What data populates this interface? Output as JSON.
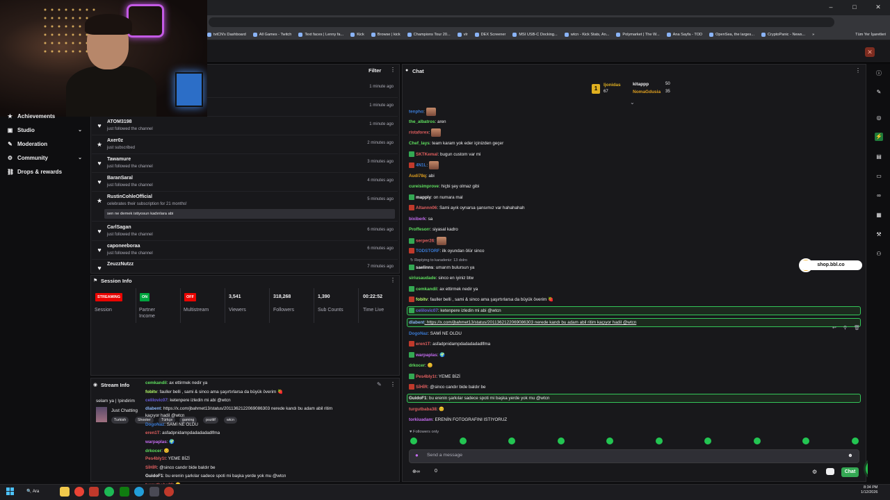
{
  "browser": {
    "bookmarks": [
      "tvtCN's Dashboard",
      "All Games - Twitch",
      "Text faces | Lenny fa...",
      "Kick",
      "Browse | kick",
      "Champions Tour 20...",
      "vlr",
      "DEX Screener",
      "MSI USB-C Docking...",
      "wtcn - Kick Stats, An...",
      "Polymarket | The W...",
      "Ana Sayfa - TOD",
      "OpenSea, the larges...",
      "CryptoPanic - News..."
    ],
    "bookmarks_more": "»",
    "all_bookmarks": "Tüm Yer İşaretleri",
    "win_controls": [
      "–",
      "□",
      "✕"
    ]
  },
  "leftnav": {
    "items": [
      {
        "label": "Achievements",
        "icon": "trophy-icon",
        "glyph": "★",
        "chev": ""
      },
      {
        "label": "Studio",
        "icon": "studio-icon",
        "glyph": "▣",
        "chev": "⌄"
      },
      {
        "label": "Moderation",
        "icon": "sword-icon",
        "glyph": "✎",
        "chev": ""
      },
      {
        "label": "Community",
        "icon": "gear-icon",
        "glyph": "⚙",
        "chev": "⌄"
      },
      {
        "label": "Drops & rewards",
        "icon": "link-icon",
        "glyph": "⛓",
        "chev": ""
      }
    ]
  },
  "activity": {
    "filter_label": "Filter",
    "dots": "⋮",
    "rows": [
      {
        "user": "",
        "sub": "",
        "time": "1 minute ago",
        "glyph": ""
      },
      {
        "user": "",
        "sub": "",
        "time": "1 minute ago",
        "glyph": ""
      },
      {
        "user": "ATOM3198",
        "sub": "just followed the channel",
        "time": "1 minute ago",
        "glyph": "♥"
      },
      {
        "user": "Axer0z",
        "sub": "just subscribed",
        "time": "2 minutes ago",
        "glyph": "★"
      },
      {
        "user": "Tawamure",
        "sub": "just followed the channel",
        "time": "3 minutes ago",
        "glyph": "♥"
      },
      {
        "user": "BaranSaral",
        "sub": "just followed the channel",
        "time": "4 minutes ago",
        "glyph": "♥"
      },
      {
        "user": "RustinCohleOfficial",
        "sub": "celebrates their subscription for 21 months!",
        "time": "5 minutes ago",
        "glyph": "★"
      },
      {
        "user": "CarlSagan",
        "sub": "just followed the channel",
        "time": "6 minutes ago",
        "glyph": "♥"
      },
      {
        "user": "caponeeboraa",
        "sub": "just followed the channel",
        "time": "6 minutes ago",
        "glyph": "♥"
      },
      {
        "user": "ZeuzzNutzz",
        "sub": "",
        "time": "7 minutes ago",
        "glyph": "♥"
      }
    ],
    "sub_message": "sen ne demek istiyosun kadınlara abi"
  },
  "session": {
    "title": "Session Info",
    "dots": "⋮",
    "icon": "⚑",
    "badges": [
      {
        "text": "STREAMING",
        "label": "Session",
        "color": "#eb0400"
      },
      {
        "text": "ON",
        "label": "Partner Income",
        "color": "#00a53f"
      },
      {
        "text": "OFF",
        "label": "Multistream",
        "color": "#eb0400"
      }
    ],
    "stats": [
      {
        "value": "3,541",
        "label": "Viewers"
      },
      {
        "value": "318,268",
        "label": "Followers"
      },
      {
        "value": "1,390",
        "label": "Sub Counts"
      },
      {
        "value": "00:22:52",
        "label": "Time Live"
      }
    ]
  },
  "streaminfo": {
    "title": "Stream Info",
    "icon": "◉",
    "edit": "✎",
    "dots": "⋮",
    "stream_title": "selam ya | !pindirim",
    "category": "Just Chatting",
    "tags": [
      "Turkish",
      "Shooter",
      "Türkçe",
      "gaming",
      "pozitif",
      "wtcn"
    ]
  },
  "mini_chat": [
    {
      "user": "cemkandil",
      "color": "#5fe05f",
      "text": ": ax ettirmek nedir ya"
    },
    {
      "user": "fobitv",
      "color": "#b6ff6b",
      "text": ": fauller belli , sami & sinco ama şaşırtırlarsa da büyük överim 🍓"
    },
    {
      "user": "celilovic07",
      "color": "#6b5fe0",
      "text": ": ketenpere izledin mi abi @wtcn"
    },
    {
      "user": "dlabent",
      "color": "#8ab4f8",
      "text": ": https://x.com/jbahmet13/status/2011362122069086303 nerede kandı bu adam abil ritim"
    },
    {
      "user": "",
      "color": "#efeff1",
      "text": "kaçıyor hadil @wtcn"
    },
    {
      "user": "DogoNaz",
      "color": "#3a7bd5",
      "text": ": SAMİ NE OLDU"
    },
    {
      "user": "eren1T",
      "color": "#e05f5f",
      "text": ": asfadpnidampdadadadadlfma"
    },
    {
      "user": "warpaplas",
      "color": "#c46cf0",
      "text": ": 🌍"
    },
    {
      "user": "drkocer",
      "color": "#5fe05f",
      "text": ": 😊"
    },
    {
      "user": "Pes4bly1t",
      "color": "#e05f5f",
      "text": ": YEME BİZİ"
    },
    {
      "user": "SİHİR",
      "color": "#e05f5f",
      "text": ": @sinco candır bide baldır be"
    },
    {
      "user": "GuidoF1",
      "color": "#efeff1",
      "text": ": bu erenin şarkılar sadece spoti mi başka yerde yok mu @wtcn"
    },
    {
      "user": "turgutbaba38",
      "color": "#e05f5f",
      "text": ": 😊"
    },
    {
      "user": "tork",
      "color": "#e05f5f",
      "text": "ERENİN FOTOGRAFINI ISTIYORUZ"
    }
  ],
  "chat": {
    "title": "Chat",
    "icon": "●",
    "dots": "⋮",
    "leaderboard": {
      "first": {
        "name": "ljonidas",
        "value": "67"
      },
      "second": {
        "name": "kitappp",
        "value": "50"
      },
      "third": {
        "name": "NomaGdusia",
        "value": "35"
      }
    },
    "reply_note": "↻ Replying to karadeniz: 13 dolro",
    "messages": [
      {
        "user": "tenpho",
        "color": "#3a7bd5",
        "text": ": ",
        "emote": true
      },
      {
        "user": "the_albatros",
        "color": "#5fe05f",
        "text": ": aren"
      },
      {
        "user": "ristaforex",
        "color": "#e05f5f",
        "text": ": ",
        "emote": true
      },
      {
        "user": "Chef_lays",
        "color": "#5fe05f",
        "text": ": team karam yok eder içinizden geçer"
      },
      {
        "user": "SKTKemal",
        "color": "#e05f5f",
        "text": ": bugun custom var mi",
        "badge": true
      },
      {
        "user": "4N1L",
        "color": "#3a7bd5",
        "text": ": ",
        "emote": true,
        "badge": true
      },
      {
        "user": "Audi78q",
        "color": "#e0a020",
        "text": ": abi"
      },
      {
        "user": "cureisimprove",
        "color": "#5fe05f",
        "text": ": hiçbi şey olmaz gibi"
      },
      {
        "user": "mappiy",
        "color": "#efeff1",
        "text": ": on numara mal",
        "badge": true
      },
      {
        "user": "Altannn06",
        "color": "#e05f5f",
        "text": ": Sami ayık oynarsa şansımız var hahahahah",
        "badge": true
      },
      {
        "user": "bixiberk",
        "color": "#c46cf0",
        "text": ": sa"
      },
      {
        "user": "Proffesorr",
        "color": "#5fe05f",
        "text": ": siyasal kadro"
      },
      {
        "user": "serper26",
        "color": "#e05f5f",
        "text": ": ",
        "emote": true,
        "badge": true
      },
      {
        "user": "TODSTORF",
        "color": "#3a7bd5",
        "text": ": ilk oyundan ölür sinco",
        "badge": true
      },
      {
        "user": "saelinns",
        "color": "#efeff1",
        "text": ": umarım bulursun ya",
        "badge": true
      },
      {
        "user": "siriusaudade",
        "color": "#5fe05f",
        "text": ": sinco en iyiniz btw"
      },
      {
        "user": "cemkandil",
        "color": "#5fe05f",
        "text": ": ax ettirmek nedir ya",
        "badge": true
      },
      {
        "user": "fobitv",
        "color": "#b6ff6b",
        "text": ": fauller belli , sami & sinco ama şaşırtırlarsa da büyük överim 🍓",
        "badge": true
      },
      {
        "user": "celilovic07",
        "color": "#6b5fe0",
        "text": ": ketenpere izledin mi abi @wtcn",
        "badge": true
      },
      {
        "user": "dlabent",
        "color": "#8ab4f8",
        "text": ": https://x.com/jbahmet13/status/2011362122069086303 nerede kandı bu adam abil ritim kaçıyor hadil @wtcn"
      },
      {
        "user": "DogoNaz",
        "color": "#3a7bd5",
        "text": ": SAMİ NE OLDU"
      },
      {
        "user": "eren1T",
        "color": "#e05f5f",
        "text": ": asfadpnidampdadadadadlfma",
        "badge": true
      },
      {
        "user": "warpaplas",
        "color": "#c46cf0",
        "text": ": 🌍",
        "badge": true
      },
      {
        "user": "drkocer",
        "color": "#5fe05f",
        "text": ": 😊"
      },
      {
        "user": "Pes4bly1t",
        "color": "#e05f5f",
        "text": ": YEME BİZİ",
        "badge": true
      },
      {
        "user": "SİHİR",
        "color": "#e05f5f",
        "text": ": @sinco candır bide baldır be",
        "badge": true
      },
      {
        "user": "GuidoF1",
        "color": "#efeff1",
        "text": ": bu erenin şarkılar sadece spoti mi başka yerde yok mu @wtcn"
      },
      {
        "user": "turgutbaba38",
        "color": "#e05f5f",
        "text": ": 😊"
      },
      {
        "user": "torkiuadam",
        "color": "#c46cf0",
        "text": ": ERENİN FOTOGRAFINI ISTIYORUZ"
      }
    ],
    "followers_only": "♥ Followers only",
    "input_placeholder": "Send a message",
    "points": "⊕∞",
    "points_count": "0",
    "chat_button": "Chat",
    "shop": "shop.bbl.co"
  },
  "taskbar": {
    "search": "Ara",
    "clock_time": "8:34 PM",
    "clock_date": "1/12/2026"
  }
}
